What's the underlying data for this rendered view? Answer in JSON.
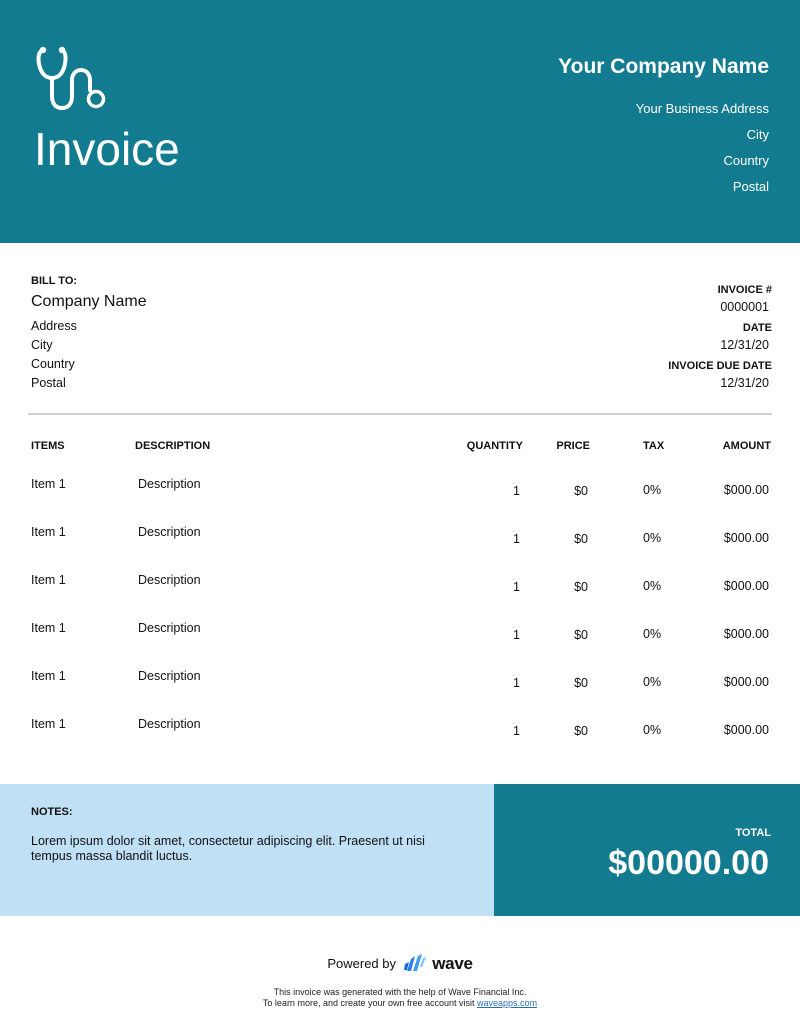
{
  "header": {
    "logo_icon": "stethoscope-icon",
    "title": "Invoice",
    "company_name": "Your Company Name",
    "address_lines": [
      "Your Business Address",
      "City",
      "Country",
      "Postal"
    ],
    "background_color": "#137b8f"
  },
  "bill_to": {
    "label": "BILL TO:",
    "company": "Company Name",
    "lines": [
      "Address",
      "City",
      "Country",
      "Postal"
    ]
  },
  "invoice_meta": {
    "number_label": "INVOICE #",
    "number": "0000001",
    "date_label": "DATE",
    "date": "12/31/20",
    "due_label": "INVOICE DUE DATE",
    "due_date": "12/31/20"
  },
  "table": {
    "headers": [
      "ITEMS",
      "DESCRIPTION",
      "QUANTITY",
      "PRICE",
      "TAX",
      "AMOUNT"
    ],
    "rows": [
      {
        "item": "Item 1",
        "description": "Description",
        "quantity": "1",
        "price": "$0",
        "tax": "0%",
        "amount": "$000.00"
      },
      {
        "item": "Item 1",
        "description": "Description",
        "quantity": "1",
        "price": "$0",
        "tax": "0%",
        "amount": "$000.00"
      },
      {
        "item": "Item 1",
        "description": "Description",
        "quantity": "1",
        "price": "$0",
        "tax": "0%",
        "amount": "$000.00"
      },
      {
        "item": "Item 1",
        "description": "Description",
        "quantity": "1",
        "price": "$0",
        "tax": "0%",
        "amount": "$000.00"
      },
      {
        "item": "Item 1",
        "description": "Description",
        "quantity": "1",
        "price": "$0",
        "tax": "0%",
        "amount": "$000.00"
      },
      {
        "item": "Item 1",
        "description": "Description",
        "quantity": "1",
        "price": "$0",
        "tax": "0%",
        "amount": "$000.00"
      }
    ]
  },
  "notes": {
    "label": "NOTES:",
    "text": "Lorem ipsum dolor sit amet, consectetur adipiscing elit. Praesent ut nisi tempus massa blandit luctus.",
    "background_color": "#bfe0f5"
  },
  "total": {
    "label": "TOTAL",
    "value": "$00000.00"
  },
  "footer": {
    "powered_by": "Powered by",
    "brand_icon": "wave-logo-icon",
    "brand": "wave",
    "line1": "This invoice was generated with the help of Wave Financial Inc.",
    "line2_prefix": "To learn more, and create your own free account visit ",
    "link_text": "waveapps.com"
  }
}
